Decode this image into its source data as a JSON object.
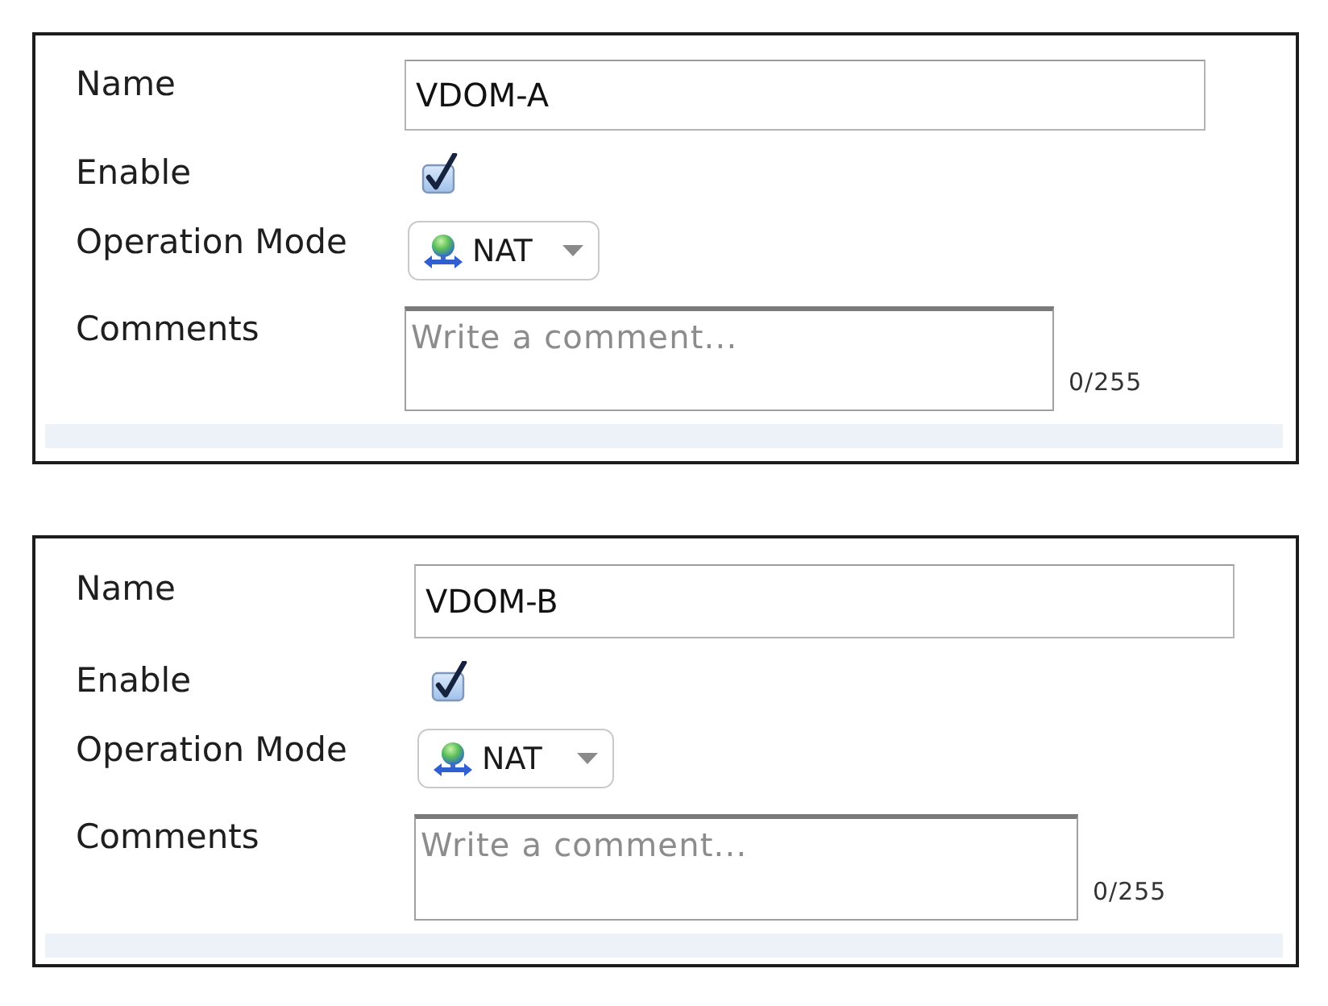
{
  "panels": [
    {
      "name": {
        "label": "Name",
        "value": "VDOM-A"
      },
      "enable": {
        "label": "Enable",
        "checked": true
      },
      "operation_mode": {
        "label": "Operation Mode",
        "value": "NAT"
      },
      "comments": {
        "label": "Comments",
        "placeholder": "Write a comment...",
        "counter": "0/255"
      }
    },
    {
      "name": {
        "label": "Name",
        "value": "VDOM-B"
      },
      "enable": {
        "label": "Enable",
        "checked": true
      },
      "operation_mode": {
        "label": "Operation Mode",
        "value": "NAT"
      },
      "comments": {
        "label": "Comments",
        "placeholder": "Write a comment...",
        "counter": "0/255"
      }
    }
  ]
}
